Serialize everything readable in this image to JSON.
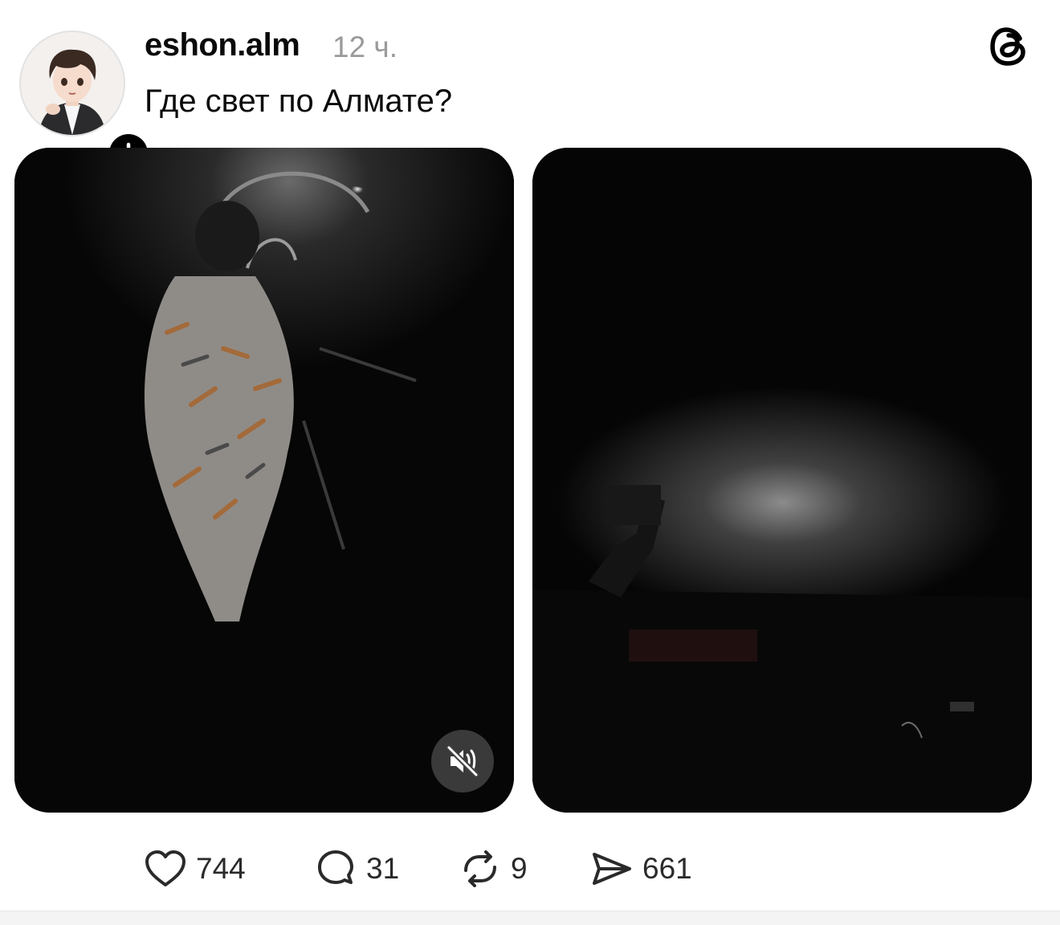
{
  "post": {
    "username": "eshon.alm",
    "timestamp": "12 ч.",
    "text": "Где свет по Алмате?"
  },
  "icons": {
    "app_logo": "threads-logo-icon",
    "follow": "plus-icon",
    "mute": "speaker-muted-icon",
    "like": "heart-icon",
    "reply": "speech-bubble-icon",
    "repost": "repost-arrows-icon",
    "share": "paper-plane-icon"
  },
  "stats": {
    "likes": "744",
    "replies": "31",
    "reposts": "9",
    "shares": "661"
  },
  "colors": {
    "text": "#0a0a0a",
    "muted": "#9a9a9a",
    "media_bg": "#050505"
  }
}
